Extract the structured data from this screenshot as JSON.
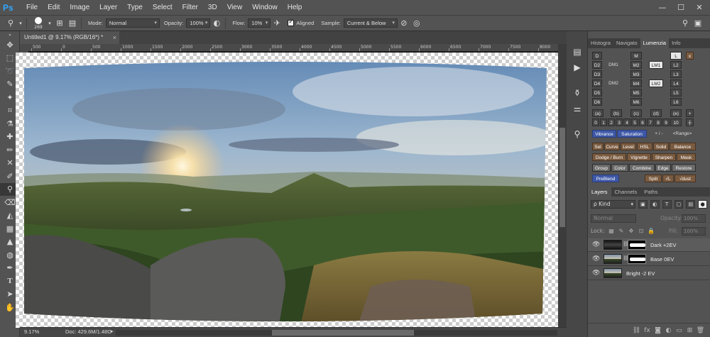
{
  "app": {
    "logo": "Ps"
  },
  "menu": [
    "File",
    "Edit",
    "Image",
    "Layer",
    "Type",
    "Select",
    "Filter",
    "3D",
    "View",
    "Window",
    "Help"
  ],
  "window_controls": {
    "minimize": "—",
    "maximize": "☐",
    "close": "✕"
  },
  "options": {
    "brush_size": "269",
    "mode_label": "Mode:",
    "mode_value": "Normal",
    "opacity_label": "Opacity:",
    "opacity_value": "100%",
    "flow_label": "Flow:",
    "flow_value": "10%",
    "aligned_label": "Aligned",
    "sample_label": "Sample:",
    "sample_value": "Current & Below"
  },
  "document": {
    "tab_title": "Untitled1 @ 9.17% (RGB/16*) *",
    "close": "×"
  },
  "ruler": {
    "top": [
      "500",
      "0",
      "500",
      "1000",
      "1500",
      "2000",
      "2500",
      "3000",
      "3500",
      "4000",
      "4500",
      "5000",
      "5500",
      "6000",
      "6500",
      "7000",
      "7500",
      "8000",
      "8500",
      "9000"
    ],
    "left": [
      "0",
      "5",
      "0",
      "1",
      "0",
      "0",
      "1",
      "5",
      "0",
      "0",
      "2",
      "0",
      "0",
      "0",
      "2",
      "5",
      "0",
      "0",
      "3",
      "0",
      "0",
      "0"
    ]
  },
  "status": {
    "zoom": "9.17%",
    "doc_size": "Doc: 429.6M/1.48G",
    "arrow": "▸"
  },
  "panel_tabs": [
    "Histogra",
    "Navigato",
    "Lumenzia",
    "Info"
  ],
  "lumenzia": {
    "d_col": [
      "D",
      "D2",
      "D3",
      "D4",
      "D5",
      "D6"
    ],
    "dm": [
      "DM1",
      "DM2"
    ],
    "m_col": [
      "M",
      "M2",
      "M3",
      "M4",
      "M5",
      "M6"
    ],
    "lm": [
      "LM1",
      "LM2"
    ],
    "l_col": [
      "L",
      "L2",
      "L3",
      "L4",
      "L5",
      "L6"
    ],
    "close": "x",
    "zones": [
      "(a)",
      "(b)",
      "(c)",
      "(d)",
      "(e)"
    ],
    "zone_plus": "+",
    "numbers": [
      "0",
      "1",
      "2",
      "3",
      "4",
      "5",
      "6",
      "7",
      "8",
      "9",
      "10"
    ],
    "zone_minus": "┼",
    "vibrance": "Vibrance",
    "saturation": "Saturation",
    "plusminus": "+ / -",
    "range": "<Range>",
    "row1": [
      "Sel",
      "Curve",
      "Level",
      "HSL",
      "Solid",
      "Balance"
    ],
    "row2": [
      "Dodge / Burn",
      "Vignette",
      "Sharpen",
      "Mask"
    ],
    "row3": [
      "Group",
      "Color",
      "Combine",
      "Edge",
      "Restore"
    ],
    "row4_left": "PreBlend",
    "row4_right": [
      "Split",
      "√L",
      "√dust"
    ]
  },
  "layers_tabs": [
    "Layers",
    "Channels",
    "Paths"
  ],
  "layers": {
    "kind": "ρ Kind",
    "blend_mode": "Normal",
    "opacity_label": "Opacity:",
    "opacity_value": "100%",
    "lock_label": "Lock:",
    "fill_label": "Fill:",
    "fill_value": "100%",
    "items": [
      {
        "name": "Dark +2EV",
        "selected": true
      },
      {
        "name": "Base 0EV",
        "selected": false
      },
      {
        "name": "Bright -2 EV",
        "selected": false
      }
    ]
  },
  "colors": {
    "ps_blue": "#31a8ff",
    "lumenzia_blue": "#3e58a8",
    "lumenzia_brown": "#7a5b40"
  }
}
